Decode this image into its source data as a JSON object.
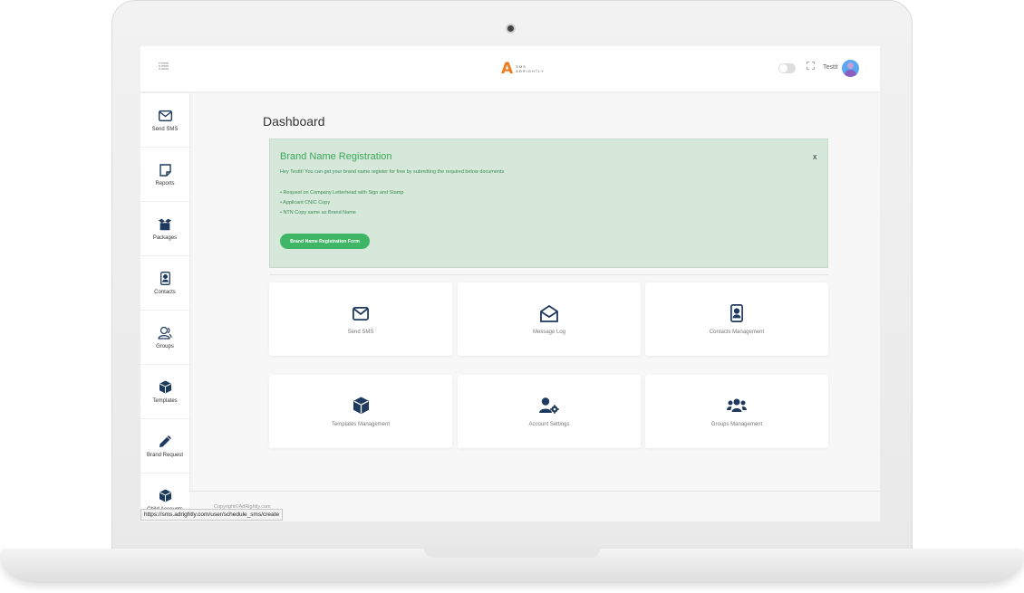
{
  "header": {
    "menu_icon": "list-icon",
    "logo_mark": "A",
    "logo_line1": "SMS",
    "logo_line2": "ADRIGHTLY",
    "username": "Testtt"
  },
  "sidebar": {
    "items": [
      {
        "label": "Send SMS",
        "icon": "envelope-icon"
      },
      {
        "label": "Reports",
        "icon": "note-icon"
      },
      {
        "label": "Packages",
        "icon": "box-open-icon"
      },
      {
        "label": "Contacts",
        "icon": "contact-card-icon"
      },
      {
        "label": "Groups",
        "icon": "users-outline-icon"
      },
      {
        "label": "Templates",
        "icon": "cube-icon"
      },
      {
        "label": "Brand Request",
        "icon": "pencil-icon"
      },
      {
        "label": "Child Accounts",
        "icon": "cube-icon"
      }
    ]
  },
  "main": {
    "title": "Dashboard",
    "alert": {
      "title": "Brand Name Registration",
      "close": "x",
      "message": "Hey Testtt! You can get your brand name register for free by submitting the required below documents",
      "items": [
        "• Request on Company Letterhead with Sign and Stamp",
        "• Applicant CNIC Copy",
        "• NTN Copy same as Brand Name"
      ],
      "button": "Brand Name Registration Form"
    },
    "cards": [
      {
        "label": "Send SMS",
        "icon": "envelope-icon"
      },
      {
        "label": "Message Log",
        "icon": "envelope-open-icon"
      },
      {
        "label": "Contacts Management",
        "icon": "contact-card-icon"
      },
      {
        "label": "Templates Management",
        "icon": "cube-icon"
      },
      {
        "label": "Account Settings",
        "icon": "user-cog-icon"
      },
      {
        "label": "Groups Management",
        "icon": "users-icon"
      }
    ]
  },
  "footer": {
    "copyright": "Copyright©AdRightly.com"
  },
  "status_url": "https://sms.adrightly.com/user/schedule_sms/create",
  "colors": {
    "accent_green": "#3fb566",
    "alert_bg": "#d5e8d9",
    "icon_navy": "#1f3a5f",
    "logo_orange": "#f07c22"
  }
}
